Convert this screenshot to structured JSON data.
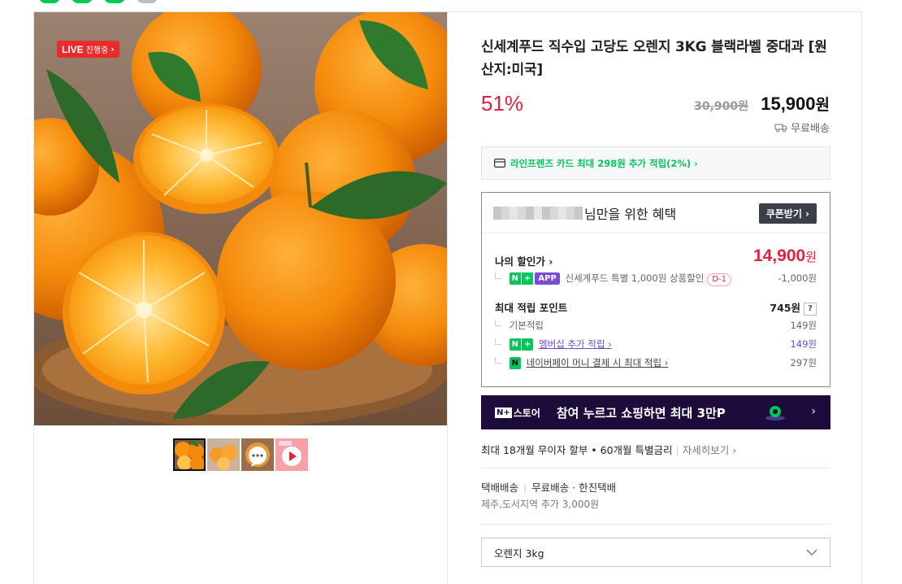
{
  "live_badge": {
    "strong": "LIVE",
    "sub": "진행중",
    "chevron": "›"
  },
  "product": {
    "title": "신세계푸드 직수입 고당도 오렌지 3KG 블랙라벨 중대과 [원산지:미국]",
    "discount": "51%",
    "original_price": "30,900원",
    "sale_price": "15,900",
    "sale_price_unit": "원",
    "delivery": "무료배송"
  },
  "card_promo": {
    "text": "라인프렌즈 카드 최대 298원 추가 적립(2%) ›"
  },
  "benefit": {
    "header_suffix": "님만을 위한 혜택",
    "coupon_button": "쿠폰받기 ›",
    "my_price_label": "나의 할인가 ›",
    "my_price_value": "14,900",
    "my_price_unit": "원",
    "app_discount_text": "신세계푸드 특별 1,000원 상품할인",
    "app_badge": "APP",
    "dday": "D-1",
    "app_discount_value": "-1,000원",
    "max_points_label": "최대 적립 포인트",
    "max_points_value": "745원",
    "qmark": "?",
    "points": [
      {
        "label": "기본적립",
        "value": "149원"
      },
      {
        "label": "멤버십 추가 적립 ›",
        "value": "149원"
      },
      {
        "label": "네이버페이 머니 결제 시 최대 적립 ›",
        "value": "297원"
      }
    ]
  },
  "store_banner": {
    "logo_box": "N+",
    "logo_text": "스토어",
    "text": "참여 누르고 쇼핑하면 최대 3만P",
    "chevron": "›"
  },
  "installment": {
    "text": "최대 18개월 무이자 할부 • 60개월 특별금리",
    "more": "자세히보기 ›"
  },
  "shipping": {
    "type": "택배배송",
    "fee": "무료배송",
    "carrier": "· 한진택배",
    "extra": "제주,도서지역 추가 3,000원"
  },
  "option_select": {
    "value": "오렌지 3kg"
  },
  "colors": {
    "naver_green": "#03c75a",
    "price_red": "#e3203f",
    "membership_purple": "#6a4bd1",
    "banner_dark": "#1d0b3b"
  }
}
